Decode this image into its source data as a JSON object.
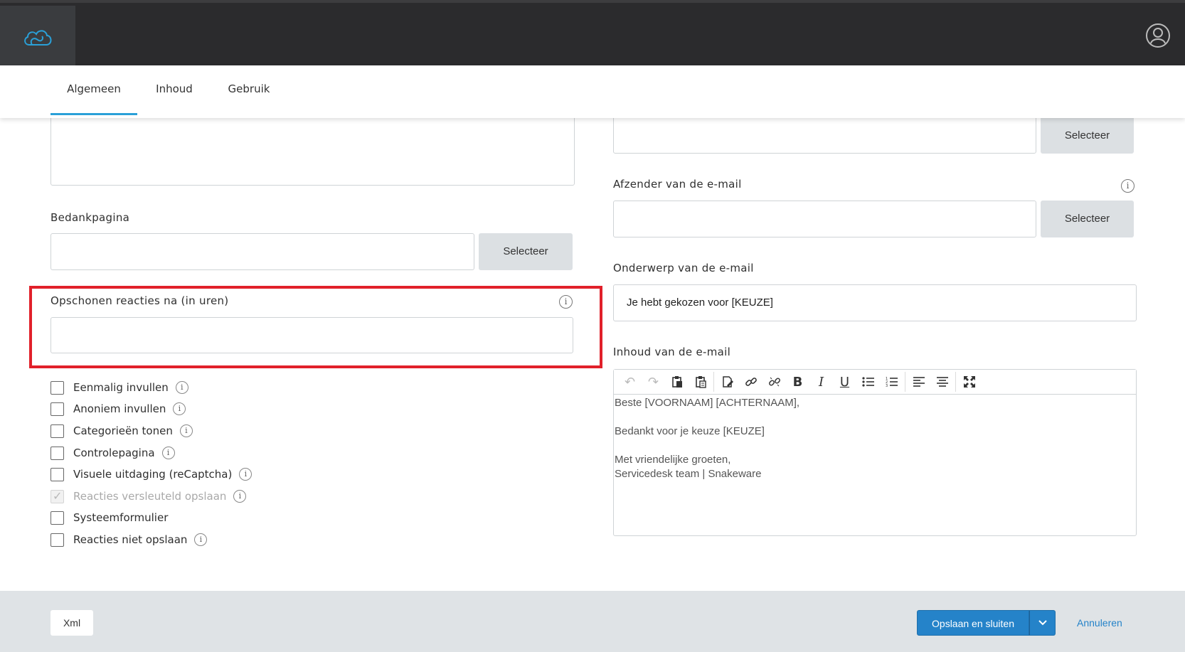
{
  "topbar": {
    "logo_icon": "cloud-logo-icon",
    "user_icon": "user-account-icon"
  },
  "tabs": [
    {
      "label": "Algemeen",
      "active": true
    },
    {
      "label": "Inhoud",
      "active": false
    },
    {
      "label": "Gebruik",
      "active": false
    }
  ],
  "left": {
    "bedankpagina": {
      "label": "Bedankpagina",
      "value": "",
      "button": "Selecteer"
    },
    "opschonen": {
      "label": "Opschonen reacties na (in uren)",
      "value": "",
      "info": "i"
    },
    "checkboxes": [
      {
        "label": "Eenmalig invullen",
        "checked": false,
        "disabled": false,
        "info": true
      },
      {
        "label": "Anoniem invullen",
        "checked": false,
        "disabled": false,
        "info": true
      },
      {
        "label": "Categorieën tonen",
        "checked": false,
        "disabled": false,
        "info": true
      },
      {
        "label": "Controlepagina",
        "checked": false,
        "disabled": false,
        "info": true
      },
      {
        "label": "Visuele uitdaging (reCaptcha)",
        "checked": false,
        "disabled": false,
        "info": true
      },
      {
        "label": "Reacties versleuteld opslaan",
        "checked": true,
        "disabled": true,
        "info": true
      },
      {
        "label": "Systeemformulier",
        "checked": false,
        "disabled": false,
        "info": false
      },
      {
        "label": "Reacties niet opslaan",
        "checked": false,
        "disabled": false,
        "info": true
      }
    ]
  },
  "right": {
    "top_select": {
      "value": "",
      "button": "Selecteer"
    },
    "afzender": {
      "label": "Afzender van de e-mail",
      "value": "",
      "button": "Selecteer",
      "info": "i"
    },
    "onderwerp": {
      "label": "Onderwerp van de e-mail",
      "value": "Je hebt gekozen voor [KEUZE]"
    },
    "inhoud": {
      "label": "Inhoud van de e-mail",
      "toolbar": [
        "undo-icon",
        "redo-icon",
        "paste-icon",
        "paste-text-icon",
        "paste-word-icon",
        "link-icon",
        "unlink-icon",
        "bold-icon",
        "italic-icon",
        "underline-icon",
        "bullet-list-icon",
        "numbered-list-icon",
        "align-left-icon",
        "align-center-icon",
        "fullscreen-icon"
      ],
      "lines": [
        "Beste [VOORNAAM] [ACHTERNAAM],",
        "",
        "Bedankt voor je keuze [KEUZE]",
        "",
        "Met vriendelijke groeten,",
        "Servicedesk team | Snakeware"
      ]
    }
  },
  "footer": {
    "xml": "Xml",
    "save": "Opslaan en sluiten",
    "cancel": "Annuleren"
  },
  "colors": {
    "accent": "#2aa0d8",
    "primary_button": "#2583c9",
    "highlight": "#e1202a",
    "topbar": "#2b2b2d"
  }
}
